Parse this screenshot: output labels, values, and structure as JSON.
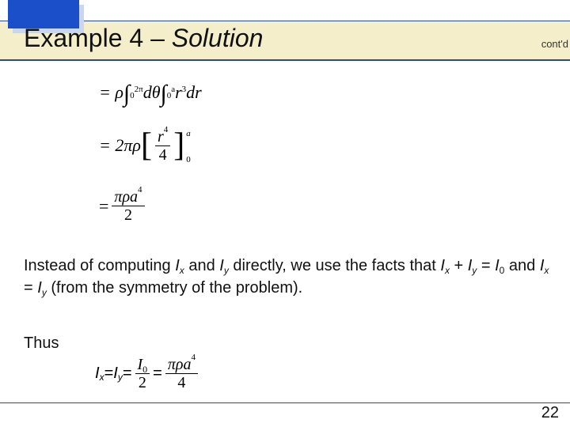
{
  "header": {
    "example_label": "Example 4",
    "dash": " – ",
    "solution_label": "Solution",
    "contd": "cont'd"
  },
  "math": {
    "line1_prefix": "= ρ",
    "line1_int1_lo": "0",
    "line1_int1_hi": "2π",
    "line1_dtheta": " dθ",
    "line1_int2_lo": "0",
    "line1_int2_hi": "a",
    "line1_r3": " r",
    "line1_r3_exp": "3",
    "line1_dr": " dr",
    "line2_prefix": "= 2πρ ",
    "line2_frac_num": "r",
    "line2_frac_num_exp": "4",
    "line2_frac_den": "4",
    "line2_lim_lo": "0",
    "line2_lim_hi": "a",
    "line3_eq": "= ",
    "line3_num": "πρa",
    "line3_num_exp": "4",
    "line3_den": "2"
  },
  "body": {
    "p1_a": "Instead of computing ",
    "p1_b": " and ",
    "p1_c": " directly, we use the facts that ",
    "p1_d": " + ",
    "p1_e": " = ",
    "p1_f": " and ",
    "p1_g": " = ",
    "p1_h": " (from the symmetry of the problem).",
    "Ix": "I",
    "x": "x",
    "Iy": "I",
    "y": "y",
    "I0": "I",
    "zero": "0",
    "thus": "Thus",
    "eq_a": " = ",
    "eq_b": " = ",
    "eq_c": " = ",
    "frac1_num": "I",
    "frac1_num_sub": "0",
    "frac1_den": "2",
    "frac2_num": "πρa",
    "frac2_num_exp": "4",
    "frac2_den": "4"
  },
  "page": {
    "number": "22"
  }
}
